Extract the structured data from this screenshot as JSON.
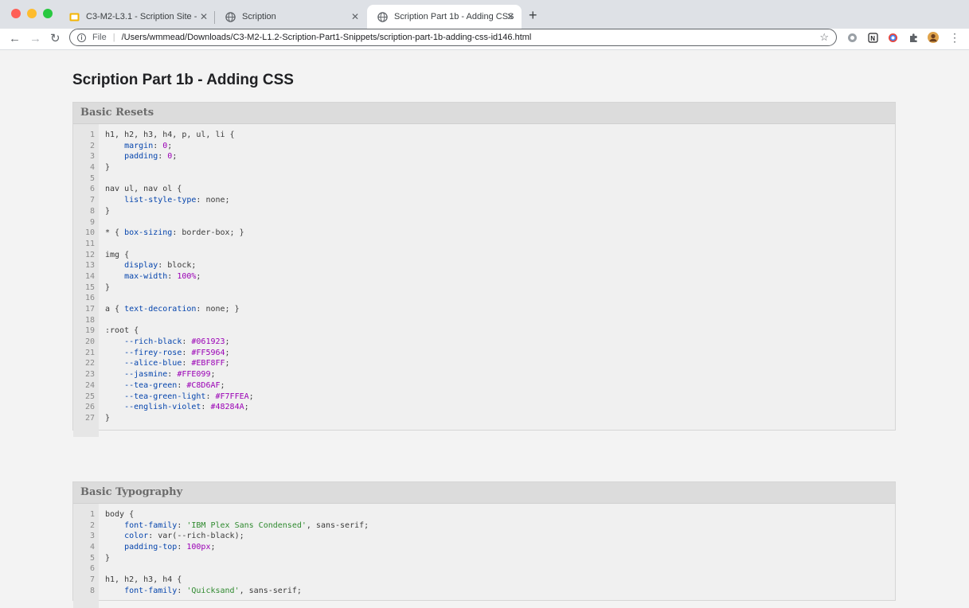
{
  "window": {
    "traffic_lights": [
      "#fe5f57",
      "#febc2e",
      "#28c840"
    ]
  },
  "tabs": [
    {
      "title": "C3-M2-L3.1 - Scription Site -  ",
      "icon": "slides-icon",
      "close": "✕",
      "active": false
    },
    {
      "title": "Scription",
      "icon": "globe-icon",
      "close": "✕",
      "active": false
    },
    {
      "title": "Scription Part 1b - Adding CSS",
      "icon": "globe-icon",
      "close": "✕",
      "active": true
    }
  ],
  "toolbar": {
    "back": "←",
    "forward": "→",
    "reload": "↻",
    "new_tab": "+",
    "omnibox_label": "File",
    "omnibox_sep": "|",
    "url": "/Users/wmmead/Downloads/C3-M2-L1.2-Scription-Part1-Snippets/scription-part-1b-adding-css-id146.html",
    "star": "☆",
    "menu": "⋮"
  },
  "page": {
    "title": "Scription Part 1b - Adding CSS"
  },
  "sections": [
    {
      "heading": "Basic Resets",
      "lines": [
        "h1, h2, h3, h4, p, ul, li {",
        "    margin: 0;",
        "    padding: 0;",
        "}",
        "",
        "nav ul, nav ol {",
        "    list-style-type: none;",
        "}",
        "",
        "* { box-sizing: border-box; }",
        "",
        "img {",
        "    display: block;",
        "    max-width: 100%;",
        "}",
        "",
        "a { text-decoration: none; }",
        "",
        ":root {",
        "    --rich-black: #061923;",
        "    --firey-rose: #FF5964;",
        "    --alice-blue: #EBF8FF;",
        "    --jasmine: #FFE099;",
        "    --tea-green: #C8D6AF;",
        "    --tea-green-light: #F7FFEA;",
        "    --english-violet: #48284A;",
        "}"
      ]
    },
    {
      "heading": "Basic Typography",
      "lines": [
        "body {",
        "    font-family: 'IBM Plex Sans Condensed', sans-serif;",
        "    color: var(--rich-black);",
        "    padding-top: 100px;",
        "}",
        "",
        "h1, h2, h3, h4 {",
        "    font-family: 'Quicksand', sans-serif;"
      ]
    }
  ]
}
